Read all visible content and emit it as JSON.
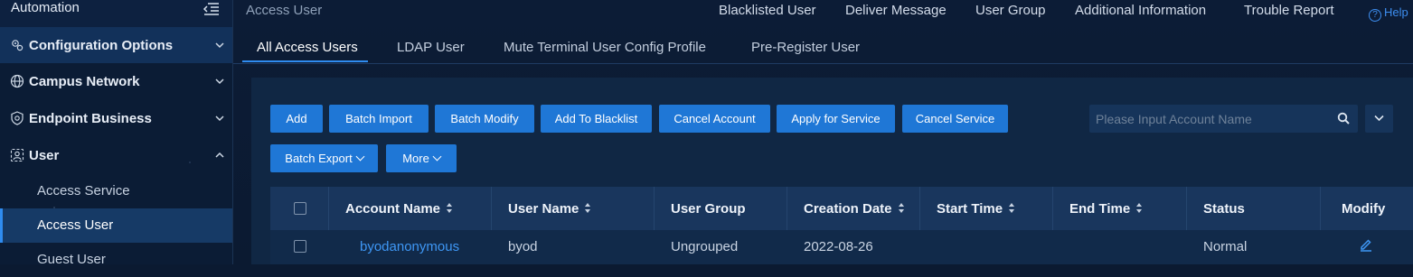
{
  "sidebar": {
    "title": "Automation",
    "groups": [
      {
        "label": "Configuration Options",
        "icon": "gear-cluster-icon"
      },
      {
        "label": "Campus Network",
        "icon": "globe-icon"
      },
      {
        "label": "Endpoint Business",
        "icon": "shield-icon"
      },
      {
        "label": "User",
        "icon": "user-group-icon"
      }
    ],
    "user_items": [
      "Access Service",
      "Access User",
      "Guest User"
    ]
  },
  "header": {
    "breadcrumb": "Access User",
    "links": [
      "Blacklisted User",
      "Deliver Message",
      "User Group",
      "Additional Information",
      "Trouble Report"
    ],
    "help": "Help"
  },
  "tabs": [
    "All Access Users",
    "LDAP User",
    "Mute Terminal User Config Profile",
    "Pre-Register User"
  ],
  "toolbar": {
    "buttons": [
      "Add",
      "Batch Import",
      "Batch Modify",
      "Add To Blacklist",
      "Cancel Account",
      "Apply for Service",
      "Cancel Service"
    ],
    "batch_export": "Batch Export",
    "more": "More",
    "search_placeholder": "Please Input Account Name"
  },
  "table": {
    "columns": [
      "Account Name",
      "User Name",
      "User Group",
      "Creation Date",
      "Start Time",
      "End Time",
      "Status",
      "Modify"
    ],
    "rows": [
      {
        "account_name": "byodanonymous",
        "user_name": "byod",
        "user_group": "Ungrouped",
        "creation_date": "2022-08-26",
        "start_time": "",
        "end_time": "",
        "status": "Normal"
      }
    ]
  },
  "colors": {
    "accent": "#1f77d6",
    "link": "#3e97f5",
    "background": "#0b1a31"
  }
}
